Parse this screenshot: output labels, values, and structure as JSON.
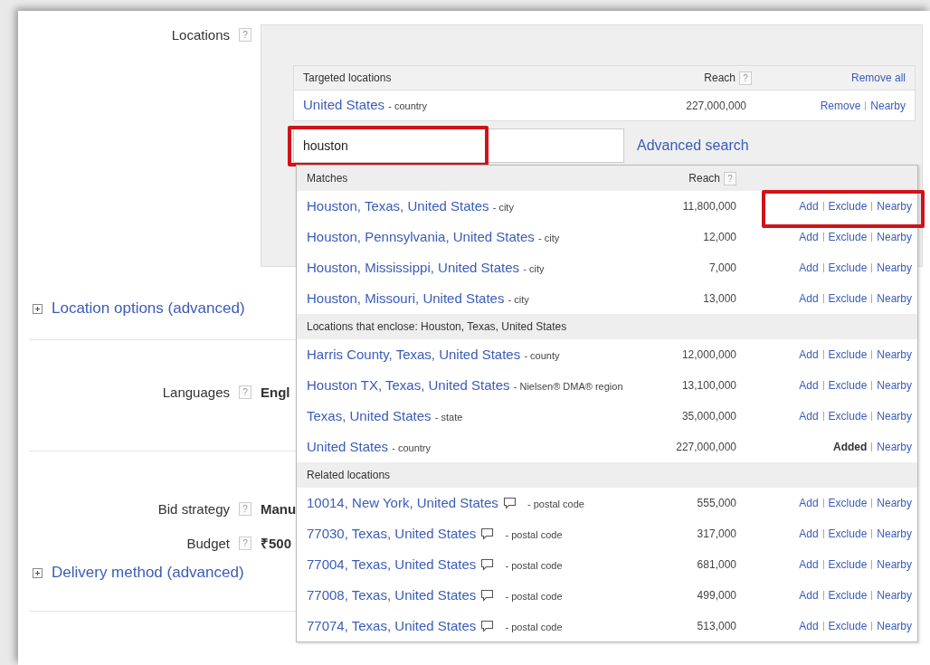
{
  "locations": {
    "label": "Locations",
    "help": "?",
    "targeted": {
      "heading": "Targeted locations",
      "reach_heading": "Reach",
      "help": "?",
      "remove_all": "Remove all",
      "rows": [
        {
          "name": "United States",
          "type": "- country",
          "reach": "227,000,000",
          "actions": [
            {
              "label": "Remove",
              "kind": "link"
            },
            {
              "label": "Nearby",
              "kind": "link"
            }
          ]
        }
      ]
    },
    "search": {
      "value": "houston",
      "highlighted": true
    },
    "advanced_search": "Advanced search"
  },
  "location_options": {
    "label": "Location options (advanced)"
  },
  "languages": {
    "label": "Languages",
    "help": "?",
    "value": "Engl"
  },
  "bid_strategy": {
    "label": "Bid strategy",
    "help": "?",
    "value": "Manu"
  },
  "budget": {
    "label": "Budget",
    "help": "?",
    "value": "₹500"
  },
  "delivery_method": {
    "label": "Delivery method (advanced)"
  },
  "dropdown": {
    "sections": [
      {
        "heading": "Matches",
        "reach_heading": "Reach",
        "help": "?",
        "rows": [
          {
            "name": "Houston, Texas, United States",
            "type": "- city",
            "note": false,
            "reach": "11,800,000",
            "highlighted": true,
            "actions": [
              {
                "label": "Add",
                "kind": "link"
              },
              {
                "label": "Exclude",
                "kind": "link"
              },
              {
                "label": "Nearby",
                "kind": "link"
              }
            ]
          },
          {
            "name": "Houston, Pennsylvania, United States",
            "type": "- city",
            "note": false,
            "reach": "12,000",
            "highlighted": false,
            "actions": [
              {
                "label": "Add",
                "kind": "link"
              },
              {
                "label": "Exclude",
                "kind": "link"
              },
              {
                "label": "Nearby",
                "kind": "link"
              }
            ]
          },
          {
            "name": "Houston, Mississippi, United States",
            "type": "- city",
            "note": false,
            "reach": "7,000",
            "highlighted": false,
            "actions": [
              {
                "label": "Add",
                "kind": "link"
              },
              {
                "label": "Exclude",
                "kind": "link"
              },
              {
                "label": "Nearby",
                "kind": "link"
              }
            ]
          },
          {
            "name": "Houston, Missouri, United States",
            "type": "- city",
            "note": false,
            "reach": "13,000",
            "highlighted": false,
            "actions": [
              {
                "label": "Add",
                "kind": "link"
              },
              {
                "label": "Exclude",
                "kind": "link"
              },
              {
                "label": "Nearby",
                "kind": "link"
              }
            ]
          }
        ]
      },
      {
        "heading": "Locations that enclose: Houston, Texas, United States",
        "rows": [
          {
            "name": "Harris County, Texas, United States",
            "type": "- county",
            "note": false,
            "reach": "12,000,000",
            "highlighted": false,
            "actions": [
              {
                "label": "Add",
                "kind": "link"
              },
              {
                "label": "Exclude",
                "kind": "link"
              },
              {
                "label": "Nearby",
                "kind": "link"
              }
            ]
          },
          {
            "name": "Houston TX, Texas, United States",
            "type": "- Nielsen® DMA® region",
            "note": false,
            "reach": "13,100,000",
            "highlighted": false,
            "actions": [
              {
                "label": "Add",
                "kind": "link"
              },
              {
                "label": "Exclude",
                "kind": "link"
              },
              {
                "label": "Nearby",
                "kind": "link"
              }
            ]
          },
          {
            "name": "Texas, United States",
            "type": "- state",
            "note": false,
            "reach": "35,000,000",
            "highlighted": false,
            "actions": [
              {
                "label": "Add",
                "kind": "link"
              },
              {
                "label": "Exclude",
                "kind": "link"
              },
              {
                "label": "Nearby",
                "kind": "link"
              }
            ]
          },
          {
            "name": "United States",
            "type": "- country",
            "note": false,
            "reach": "227,000,000",
            "highlighted": false,
            "actions": [
              {
                "label": "Added",
                "kind": "status"
              },
              {
                "label": "Nearby",
                "kind": "link"
              }
            ]
          }
        ]
      },
      {
        "heading": "Related locations",
        "rows": [
          {
            "name": "10014, New York, United States",
            "type": "- postal code",
            "note": true,
            "reach": "555,000",
            "highlighted": false,
            "actions": [
              {
                "label": "Add",
                "kind": "link"
              },
              {
                "label": "Exclude",
                "kind": "link"
              },
              {
                "label": "Nearby",
                "kind": "link"
              }
            ]
          },
          {
            "name": "77030, Texas, United States",
            "type": "- postal code",
            "note": true,
            "reach": "317,000",
            "highlighted": false,
            "actions": [
              {
                "label": "Add",
                "kind": "link"
              },
              {
                "label": "Exclude",
                "kind": "link"
              },
              {
                "label": "Nearby",
                "kind": "link"
              }
            ]
          },
          {
            "name": "77004, Texas, United States",
            "type": "- postal code",
            "note": true,
            "reach": "681,000",
            "highlighted": false,
            "actions": [
              {
                "label": "Add",
                "kind": "link"
              },
              {
                "label": "Exclude",
                "kind": "link"
              },
              {
                "label": "Nearby",
                "kind": "link"
              }
            ]
          },
          {
            "name": "77008, Texas, United States",
            "type": "- postal code",
            "note": true,
            "reach": "499,000",
            "highlighted": false,
            "actions": [
              {
                "label": "Add",
                "kind": "link"
              },
              {
                "label": "Exclude",
                "kind": "link"
              },
              {
                "label": "Nearby",
                "kind": "link"
              }
            ]
          },
          {
            "name": "77074, Texas, United States",
            "type": "- postal code",
            "note": true,
            "reach": "513,000",
            "highlighted": false,
            "actions": [
              {
                "label": "Add",
                "kind": "link"
              },
              {
                "label": "Exclude",
                "kind": "link"
              },
              {
                "label": "Nearby",
                "kind": "link"
              }
            ]
          }
        ]
      }
    ]
  }
}
